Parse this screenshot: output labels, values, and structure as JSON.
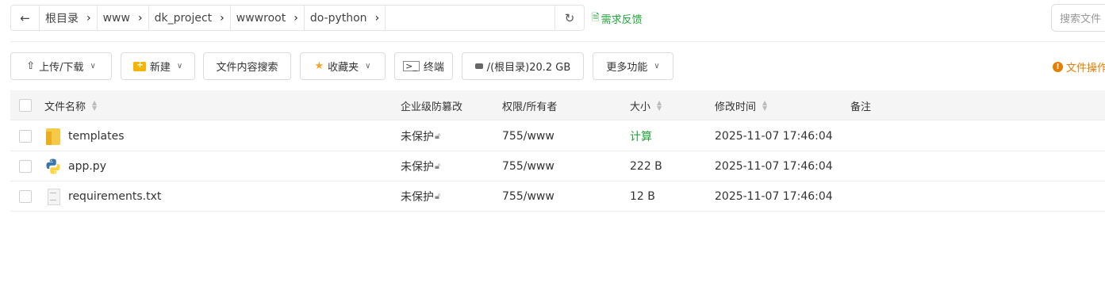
{
  "breadcrumb": {
    "back_icon": "arrow-left-icon",
    "items": [
      "根目录",
      "www",
      "dk_project",
      "wwwroot",
      "do-python"
    ],
    "refresh_icon": "refresh-icon"
  },
  "feedback_link": "需求反馈",
  "search": {
    "placeholder": "搜索文件"
  },
  "toolbar": {
    "upload_download": "上传/下载",
    "new": "新建",
    "content_search": "文件内容搜索",
    "favorites": "收藏夹",
    "terminal": "终端",
    "disk": "/(根目录)20.2 GB",
    "more": "更多功能"
  },
  "ops_warning": "文件操作",
  "table": {
    "headers": {
      "name": "文件名称",
      "tamper": "企业级防篡改",
      "perm": "权限/所有者",
      "size": "大小",
      "mtime": "修改时间",
      "note": "备注"
    },
    "rows": [
      {
        "name": "templates",
        "icon": "folder-icon",
        "tamper": "未保护",
        "perm": "755/www",
        "size": "计算",
        "mtime": "2025-11-07 17:46:04"
      },
      {
        "name": "app.py",
        "icon": "python-file-icon",
        "tamper": "未保护",
        "perm": "755/www",
        "size": "222 B",
        "mtime": "2025-11-07 17:46:04"
      },
      {
        "name": "requirements.txt",
        "icon": "text-file-icon",
        "tamper": "未保护",
        "perm": "755/www",
        "size": "12 B",
        "mtime": "2025-11-07 17:46:04"
      }
    ]
  },
  "colors": {
    "accent": "#20a53a",
    "warning": "#e67e00",
    "folder": "#f7c948"
  }
}
